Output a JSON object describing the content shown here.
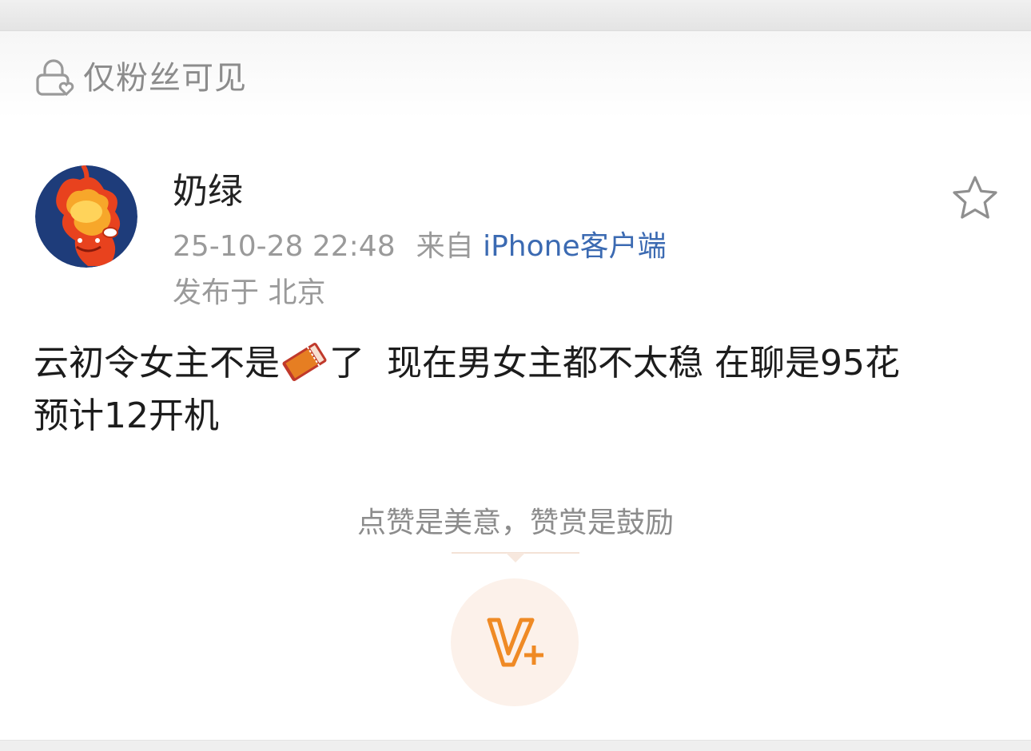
{
  "visibility": {
    "label": "仅粉丝可见",
    "icon": "lock-icon"
  },
  "post": {
    "author": {
      "name": "奶绿",
      "avatar_icon": "avatar-cartoon"
    },
    "timestamp": "25-10-28 22:48",
    "source_prefix": "来自",
    "source_client": "iPhone客户端",
    "location": "发布于 北京",
    "body": {
      "line1_before": "云初令女主不是",
      "line1_after": "了  现在男女主都不太稳 在聊是95花",
      "line2": "预计12开机",
      "inline_emoji": "ticket-emoji"
    }
  },
  "reward": {
    "note": "点赞是美意，赞赏是鼓励",
    "button_icon": "v-plus-icon"
  },
  "colors": {
    "accent_link": "#3b6ab2",
    "reward_orange": "#ef8a25",
    "reward_bg": "#fcf1ea",
    "muted_text": "#8c8c8c"
  }
}
